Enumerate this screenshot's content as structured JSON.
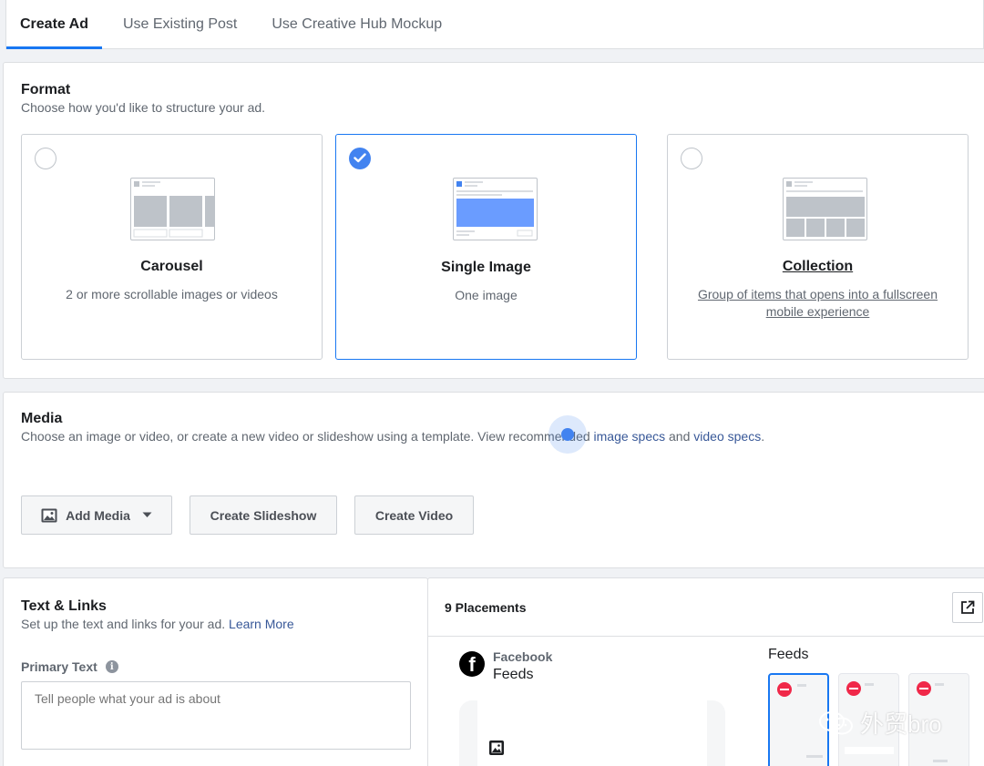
{
  "tabs": [
    {
      "label": "Create Ad",
      "active": true
    },
    {
      "label": "Use Existing Post",
      "active": false
    },
    {
      "label": "Use Creative Hub Mockup",
      "active": false
    }
  ],
  "format": {
    "title": "Format",
    "subtitle": "Choose how you'd like to structure your ad.",
    "options": [
      {
        "title": "Carousel",
        "description": "2 or more scrollable images or videos",
        "selected": false
      },
      {
        "title": "Single Image",
        "description": "One image",
        "selected": true
      },
      {
        "title": "Collection",
        "description": "Group of items that opens into a fullscreen mobile experience",
        "selected": false
      }
    ]
  },
  "media": {
    "title": "Media",
    "subtitle_prefix": "Choose an image or video, or create a new video or slideshow using a template. View recommended ",
    "image_specs_link": "image specs",
    "and_text": " and ",
    "video_specs_link": "video specs",
    "period": ".",
    "buttons": {
      "add_media": "Add Media",
      "create_slideshow": "Create Slideshow",
      "create_video": "Create Video"
    }
  },
  "text_links": {
    "title": "Text & Links",
    "subtitle": "Set up the text and links for your ad.",
    "learn_more": "Learn More",
    "primary_text_label": "Primary Text",
    "primary_text_placeholder": "Tell people what your ad is about"
  },
  "placements": {
    "title": "9 Placements",
    "platform": "Facebook",
    "platform_sub": "Feeds",
    "feeds_label": "Feeds"
  },
  "watermark": {
    "text": "外贸bro"
  },
  "colors": {
    "accent": "#1877f2",
    "link": "#385898",
    "check": "#4283f0",
    "blocked": "#f02849"
  }
}
